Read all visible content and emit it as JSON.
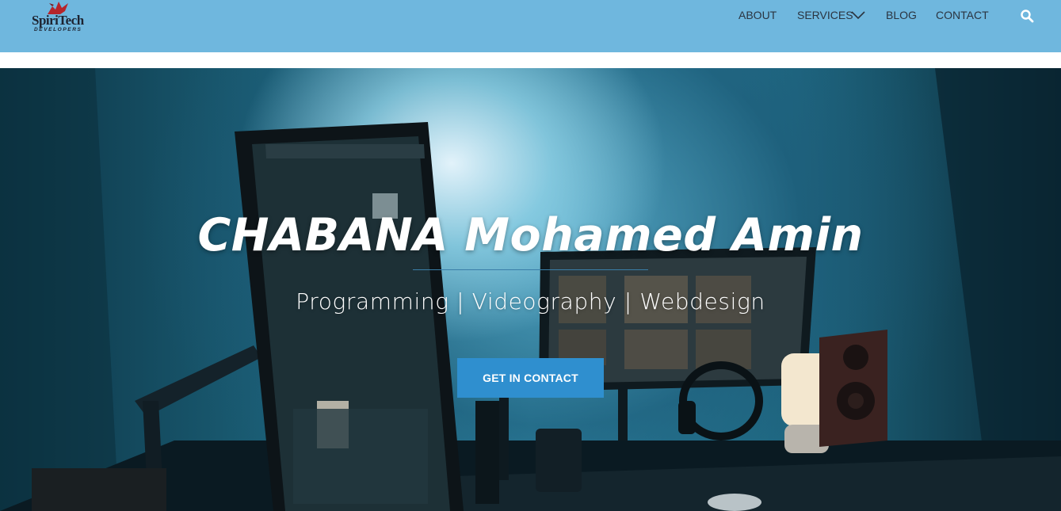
{
  "brand": {
    "name": "SpiriTech",
    "tagline": "DEVELOPERS"
  },
  "nav": {
    "items": [
      {
        "label": "ABOUT"
      },
      {
        "label": "SERVICES"
      },
      {
        "label": "BLOG"
      },
      {
        "label": "CONTACT"
      }
    ],
    "search_icon": "search-icon",
    "services_icon": "chevron-down-icon"
  },
  "hero": {
    "title": "CHABANA Mohamed Amin",
    "subtitle": "Programming | Videography | Webdesign",
    "cta_label": "GET IN CONTACT",
    "background": "desk-setup-photo"
  },
  "colors": {
    "header_bg": "#6fb7de",
    "nav_text": "#2b3440",
    "cta_bg": "#2f8fcf",
    "rule": "#3a7ea8",
    "logo_accent": "#b5252b"
  }
}
